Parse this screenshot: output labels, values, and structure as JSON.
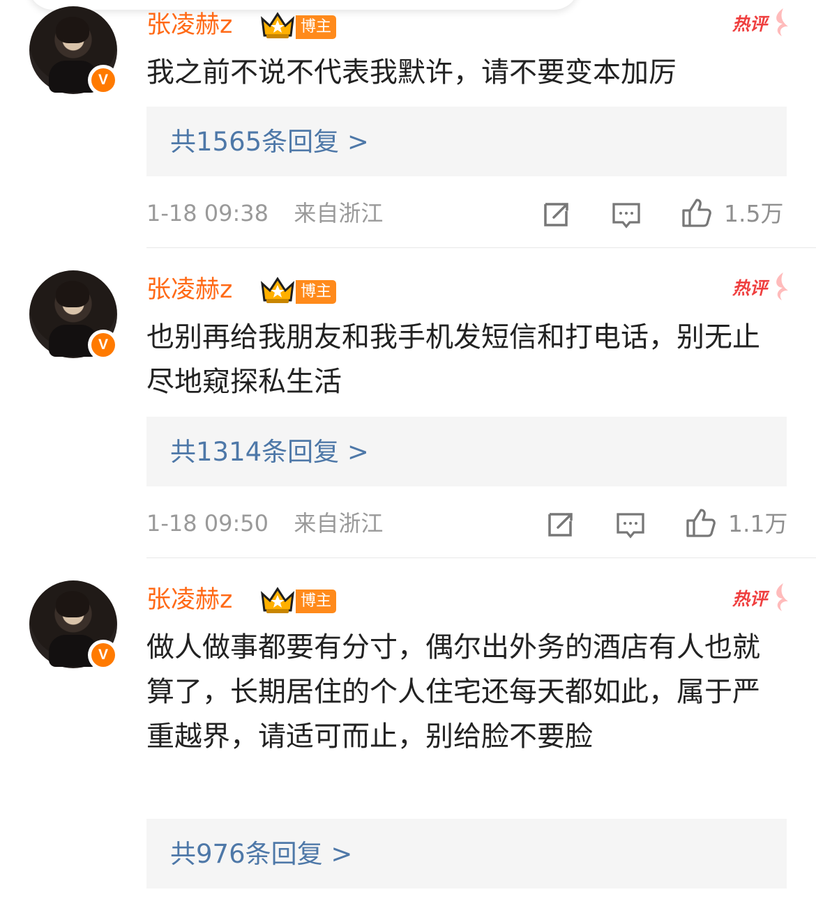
{
  "comments": [
    {
      "username": "张凌赫z",
      "badge": "博主",
      "hot_label": "热评",
      "text": "我之前不说不代表我默许，请不要变本加厉",
      "reply_summary": "共1565条回复 >",
      "time": "1-18 09:38",
      "location": "来自浙江",
      "likes": "1.5万"
    },
    {
      "username": "张凌赫z",
      "badge": "博主",
      "hot_label": "热评",
      "text": "也别再给我朋友和我手机发短信和打电话，别无止尽地窥探私生活",
      "reply_summary": "共1314条回复 >",
      "time": "1-18 09:50",
      "location": "来自浙江",
      "likes": "1.1万"
    },
    {
      "username": "张凌赫z",
      "badge": "博主",
      "hot_label": "热评",
      "text": "做人做事都要有分寸，偶尔出外务的酒店有人也就算了，长期居住的个人住宅还每天都如此，属于严重越界，请适可而止，别给脸不要脸",
      "reply_summary": "共976条回复 >"
    }
  ],
  "badge_letter": "V",
  "colors": {
    "username": "#ff6a17",
    "reply_link": "#4e78a8",
    "meta": "#9a9a9a",
    "badge": "#ff8a1b",
    "hot": "#ef3f3f"
  },
  "icons": {
    "verified": "verified-badge-icon",
    "crown": "crown-icon",
    "hot": "hot-comment-icon",
    "repost": "repost-icon",
    "comment": "comment-icon",
    "like": "like-icon"
  }
}
